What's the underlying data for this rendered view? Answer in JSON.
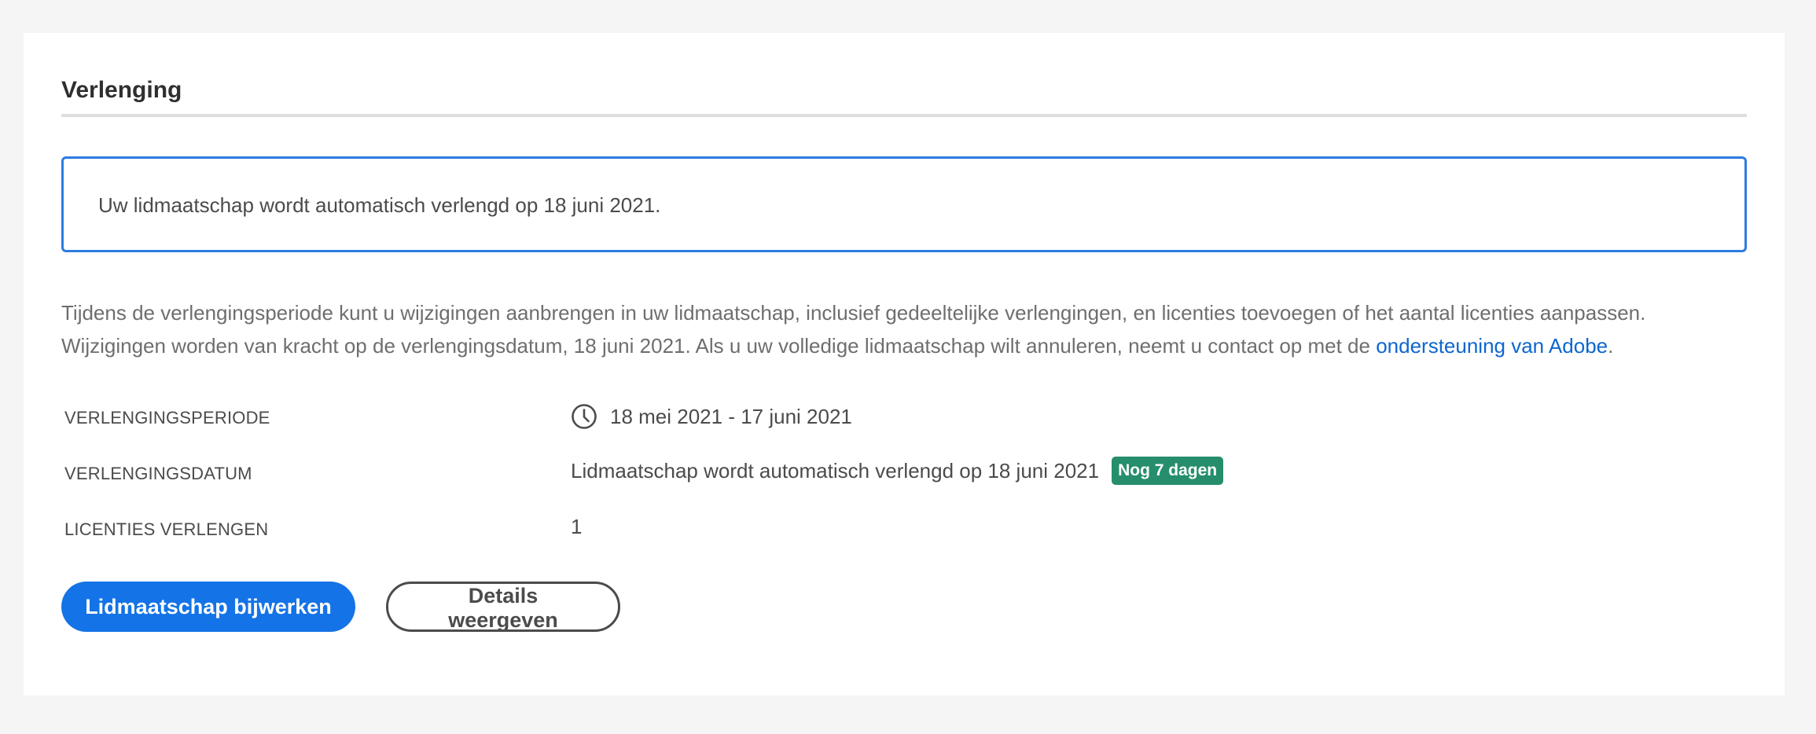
{
  "section": {
    "title": "Verlenging"
  },
  "notice": {
    "text": "Uw lidmaatschap wordt automatisch verlengd op 18 juni 2021."
  },
  "description": {
    "text": "Tijdens de verlengingsperiode kunt u wijzigingen aanbrengen in uw lidmaatschap, inclusief gedeeltelijke verlengingen, en licenties toevoegen of het aantal licenties aanpassen. Wijzigingen worden van kracht op de verlengingsdatum, 18 juni 2021. Als u uw volledige lidmaatschap wilt annuleren, neemt u contact op met de ",
    "link_label": "ondersteuning van Adobe",
    "suffix": "."
  },
  "details": {
    "period": {
      "label": "VERLENGINGSPERIODE",
      "icon": "clock-icon",
      "value": "18 mei 2021 - 17 juni 2021"
    },
    "date": {
      "label": "VERLENGINGSDATUM",
      "value": "Lidmaatschap wordt automatisch verlengd op 18 juni 2021",
      "badge": "Nog 7 dagen"
    },
    "licenses": {
      "label": "LICENTIES VERLENGEN",
      "value": "1"
    }
  },
  "actions": {
    "primary_label": "Lidmaatschap bijwerken",
    "secondary_label": "Details weergeven"
  },
  "colors": {
    "accent": "#1473e6",
    "link": "#0d66d0",
    "info_border": "#2d7be0",
    "badge_bg": "#268e6c",
    "page_bg": "#f5f5f5"
  }
}
